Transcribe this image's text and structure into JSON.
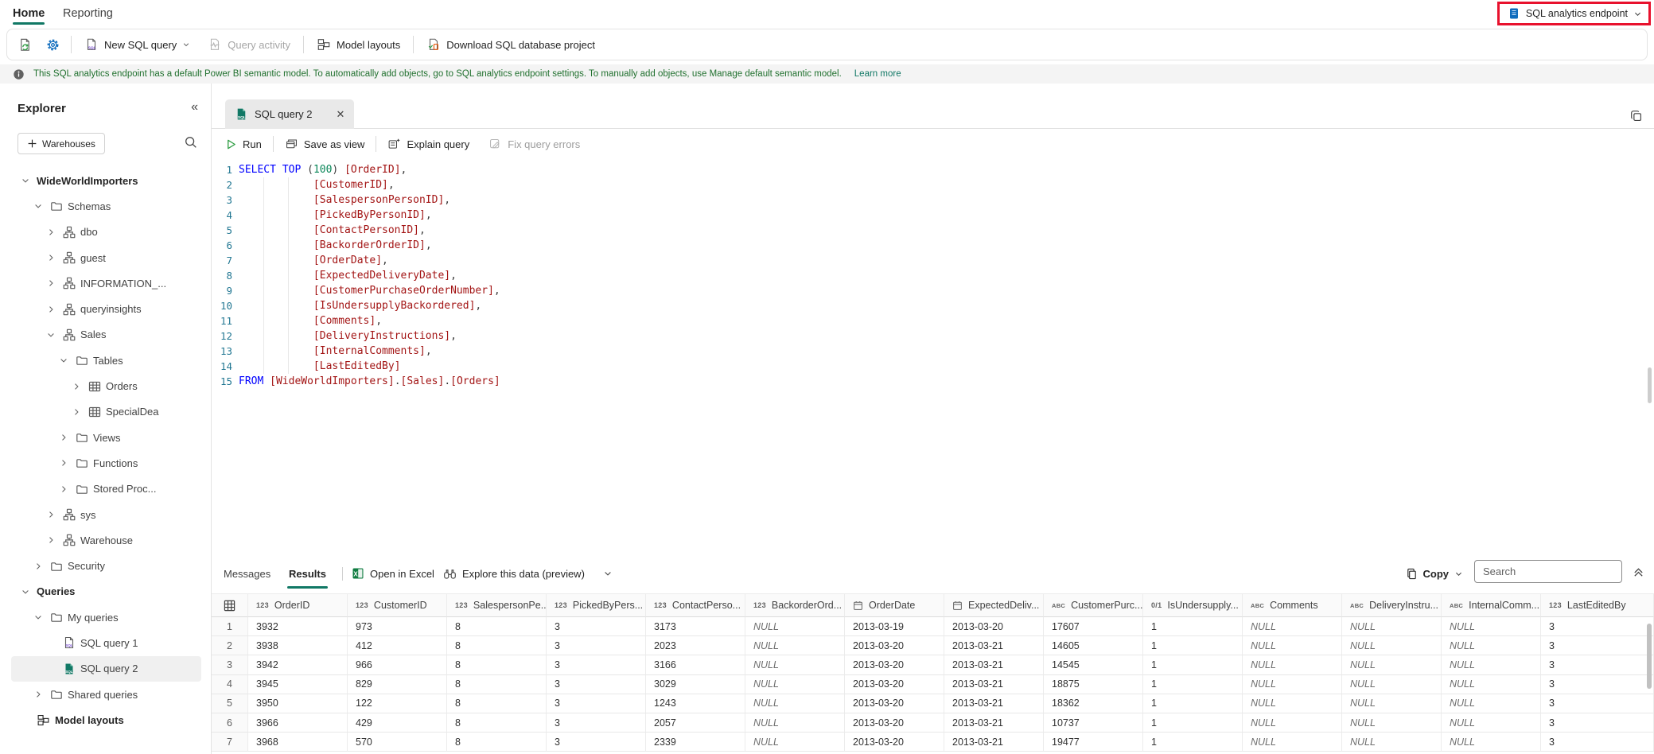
{
  "topbar": {
    "tabs": [
      {
        "label": "Home",
        "active": true
      },
      {
        "label": "Reporting",
        "active": false
      }
    ],
    "endpoint_label": "SQL analytics endpoint"
  },
  "ribbon": {
    "new_sql_query": "New SQL query",
    "query_activity": "Query activity",
    "model_layouts": "Model layouts",
    "download_project": "Download SQL database project"
  },
  "banner": {
    "message": "This SQL analytics endpoint has a default Power BI semantic model. To automatically add objects, go to SQL analytics endpoint settings. To manually add objects, use Manage default semantic model.",
    "link": "Learn more"
  },
  "explorer": {
    "title": "Explorer",
    "new_warehouse_button": "Warehouses",
    "tree": [
      {
        "label": "WideWorldImporters",
        "depth": 0,
        "icon": "none",
        "chevron": "down",
        "bold": true,
        "selected": false
      },
      {
        "label": "Schemas",
        "depth": 1,
        "icon": "folder",
        "chevron": "down",
        "bold": false,
        "selected": false
      },
      {
        "label": "dbo",
        "depth": 2,
        "icon": "schema",
        "chevron": "right",
        "bold": false,
        "selected": false
      },
      {
        "label": "guest",
        "depth": 2,
        "icon": "schema",
        "chevron": "right",
        "bold": false,
        "selected": false
      },
      {
        "label": "INFORMATION_...",
        "depth": 2,
        "icon": "schema",
        "chevron": "right",
        "bold": false,
        "selected": false
      },
      {
        "label": "queryinsights",
        "depth": 2,
        "icon": "schema",
        "chevron": "right",
        "bold": false,
        "selected": false
      },
      {
        "label": "Sales",
        "depth": 2,
        "icon": "schema",
        "chevron": "down",
        "bold": false,
        "selected": false
      },
      {
        "label": "Tables",
        "depth": 3,
        "icon": "folder",
        "chevron": "down",
        "bold": false,
        "selected": false
      },
      {
        "label": "Orders",
        "depth": 4,
        "icon": "table",
        "chevron": "right",
        "bold": false,
        "selected": false
      },
      {
        "label": "SpecialDea",
        "depth": 4,
        "icon": "table",
        "chevron": "right",
        "bold": false,
        "selected": false
      },
      {
        "label": "Views",
        "depth": 3,
        "icon": "folder",
        "chevron": "right",
        "bold": false,
        "selected": false
      },
      {
        "label": "Functions",
        "depth": 3,
        "icon": "folder",
        "chevron": "right",
        "bold": false,
        "selected": false
      },
      {
        "label": "Stored Proc...",
        "depth": 3,
        "icon": "folder",
        "chevron": "right",
        "bold": false,
        "selected": false
      },
      {
        "label": "sys",
        "depth": 2,
        "icon": "schema",
        "chevron": "right",
        "bold": false,
        "selected": false
      },
      {
        "label": "Warehouse",
        "depth": 2,
        "icon": "schema",
        "chevron": "right",
        "bold": false,
        "selected": false
      },
      {
        "label": "Security",
        "depth": 1,
        "icon": "folder",
        "chevron": "right",
        "bold": false,
        "selected": false
      },
      {
        "label": "Queries",
        "depth": 0,
        "icon": "none",
        "chevron": "down",
        "bold": true,
        "selected": false
      },
      {
        "label": "My queries",
        "depth": 1,
        "icon": "folder",
        "chevron": "down",
        "bold": false,
        "selected": false
      },
      {
        "label": "SQL query 1",
        "depth": 2,
        "icon": "sqlfile",
        "chevron": "none",
        "bold": false,
        "selected": false
      },
      {
        "label": "SQL query 2",
        "depth": 2,
        "icon": "sqlfile-active",
        "chevron": "none",
        "bold": false,
        "selected": true
      },
      {
        "label": "Shared queries",
        "depth": 1,
        "icon": "folder",
        "chevron": "right",
        "bold": false,
        "selected": false
      },
      {
        "label": "Model layouts",
        "depth": 0,
        "icon": "model",
        "chevron": "none",
        "bold": true,
        "selected": false
      }
    ]
  },
  "editor": {
    "tab_title": "SQL query 2",
    "toolbar": {
      "run": "Run",
      "save_as_view": "Save as view",
      "explain_query": "Explain query",
      "fix_query_errors": "Fix query errors"
    },
    "code_lines": [
      "SELECT TOP (100) [OrderID],",
      "            [CustomerID],",
      "            [SalespersonPersonID],",
      "            [PickedByPersonID],",
      "            [ContactPersonID],",
      "            [BackorderOrderID],",
      "            [OrderDate],",
      "            [ExpectedDeliveryDate],",
      "            [CustomerPurchaseOrderNumber],",
      "            [IsUndersupplyBackordered],",
      "            [Comments],",
      "            [DeliveryInstructions],",
      "            [InternalComments],",
      "            [LastEditedBy]",
      "FROM [WideWorldImporters].[Sales].[Orders]"
    ]
  },
  "results": {
    "tabs": [
      {
        "label": "Messages",
        "active": false
      },
      {
        "label": "Results",
        "active": true
      }
    ],
    "open_in_excel": "Open in Excel",
    "explore_label": "Explore this data (preview)",
    "copy_label": "Copy",
    "search_placeholder": "Search",
    "columns": [
      {
        "label": "OrderID",
        "type": "int"
      },
      {
        "label": "CustomerID",
        "type": "int"
      },
      {
        "label": "SalespersonPe...",
        "type": "int"
      },
      {
        "label": "PickedByPers...",
        "type": "int"
      },
      {
        "label": "ContactPerso...",
        "type": "int"
      },
      {
        "label": "BackorderOrd...",
        "type": "int"
      },
      {
        "label": "OrderDate",
        "type": "date"
      },
      {
        "label": "ExpectedDeliv...",
        "type": "date"
      },
      {
        "label": "CustomerPurc...",
        "type": "text"
      },
      {
        "label": "IsUndersupply...",
        "type": "bit"
      },
      {
        "label": "Comments",
        "type": "text"
      },
      {
        "label": "DeliveryInstru...",
        "type": "text"
      },
      {
        "label": "InternalComm...",
        "type": "text"
      },
      {
        "label": "LastEditedBy",
        "type": "int"
      }
    ],
    "rows": [
      [
        "3932",
        "973",
        "8",
        "3",
        "3173",
        "NULL",
        "2013-03-19",
        "2013-03-20",
        "17607",
        "1",
        "NULL",
        "NULL",
        "NULL",
        "3"
      ],
      [
        "3938",
        "412",
        "8",
        "3",
        "2023",
        "NULL",
        "2013-03-20",
        "2013-03-21",
        "14605",
        "1",
        "NULL",
        "NULL",
        "NULL",
        "3"
      ],
      [
        "3942",
        "966",
        "8",
        "3",
        "3166",
        "NULL",
        "2013-03-20",
        "2013-03-21",
        "14545",
        "1",
        "NULL",
        "NULL",
        "NULL",
        "3"
      ],
      [
        "3945",
        "829",
        "8",
        "3",
        "3029",
        "NULL",
        "2013-03-20",
        "2013-03-21",
        "18875",
        "1",
        "NULL",
        "NULL",
        "NULL",
        "3"
      ],
      [
        "3950",
        "122",
        "8",
        "3",
        "1243",
        "NULL",
        "2013-03-20",
        "2013-03-21",
        "18362",
        "1",
        "NULL",
        "NULL",
        "NULL",
        "3"
      ],
      [
        "3966",
        "429",
        "8",
        "3",
        "2057",
        "NULL",
        "2013-03-20",
        "2013-03-21",
        "10737",
        "1",
        "NULL",
        "NULL",
        "NULL",
        "3"
      ],
      [
        "3968",
        "570",
        "8",
        "3",
        "2339",
        "NULL",
        "2013-03-20",
        "2013-03-21",
        "19477",
        "1",
        "NULL",
        "NULL",
        "NULL",
        "3"
      ]
    ]
  },
  "colors": {
    "accent_green": "#117865",
    "annotation_red": "#e8112d",
    "keyword_blue": "#0000ff",
    "identifier_red": "#a31515",
    "number_green": "#098658"
  }
}
